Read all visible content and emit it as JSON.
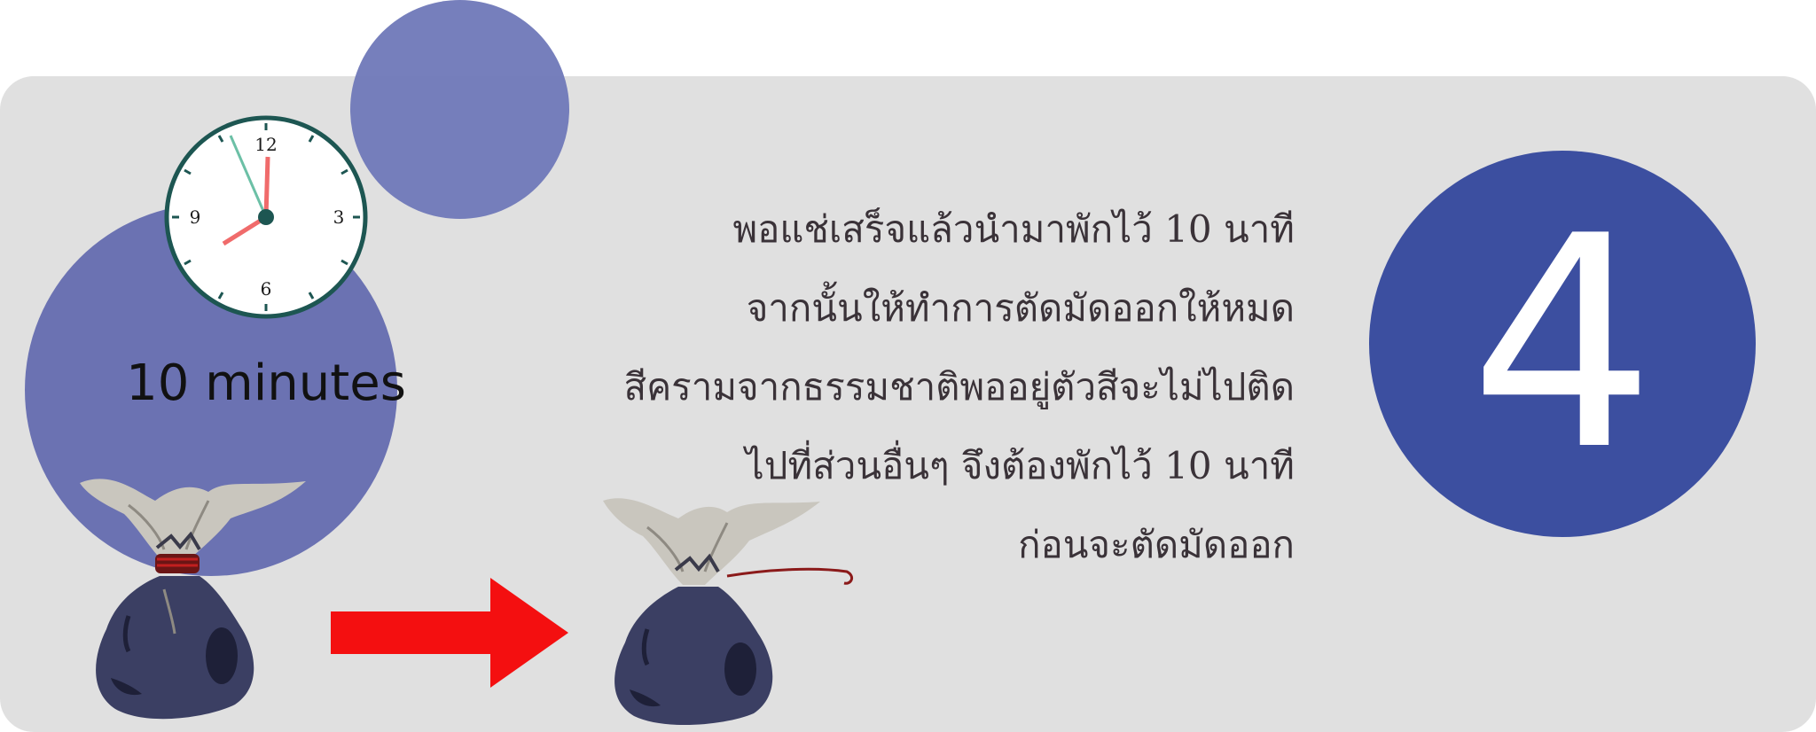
{
  "step": {
    "number": "4"
  },
  "timer": {
    "label": "10 minutes",
    "clock_numbers": [
      "12",
      "3",
      "6",
      "9"
    ]
  },
  "instructions": {
    "lines": [
      "พอแช่เสร็จแล้วนำมาพักไว้ 10 นาที",
      "จากนั้นให้ทำการตัดมัดออกให้หมด",
      "สีครามจากธรรมชาติพออยู่ตัวสีจะไม่ไปติด",
      "ไปที่ส่วนอื่นๆ จึงต้องพักไว้ 10 นาที",
      "ก่อนจะตัดมัดออก"
    ]
  },
  "colors": {
    "panel": "#e0e0e0",
    "circle_light": "#6f78b8",
    "step_circle": "#3c4fa0",
    "arrow": "#f40f10",
    "bag_dye": "#3b3f63",
    "bag_cloth": "#c9c6be",
    "tie_string": "#8b1a1a"
  },
  "icons": [
    "clock-icon",
    "tied-bag-icon",
    "right-arrow-icon",
    "untied-bag-icon"
  ]
}
